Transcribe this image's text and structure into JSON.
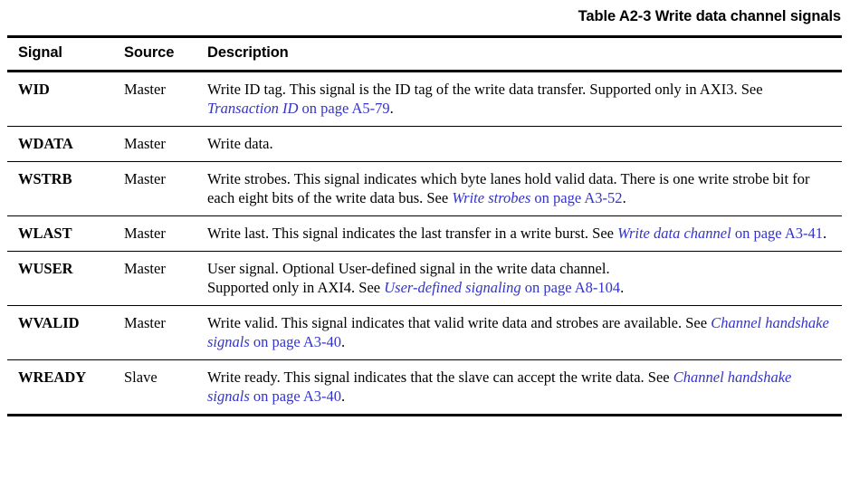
{
  "title": "Table A2-3 Write data channel signals",
  "colors": {
    "text": "#000000",
    "link": "#3333cc",
    "rule": "#000000",
    "background": "#ffffff"
  },
  "table": {
    "columns": [
      {
        "key": "signal",
        "label": "Signal"
      },
      {
        "key": "source",
        "label": "Source"
      },
      {
        "key": "description",
        "label": "Description"
      }
    ],
    "rows": [
      {
        "signal": "WID",
        "source": "Master",
        "description_lines": [
          {
            "text": "Write ID tag. This signal is the ID tag of the write data transfer. Supported only in AXI3. See ",
            "xref_title": "Transaction ID",
            "xref_page": " on page A5-79",
            "tail": "."
          }
        ]
      },
      {
        "signal": "WDATA",
        "source": "Master",
        "description_lines": [
          {
            "text": "Write data.",
            "xref_title": "",
            "xref_page": "",
            "tail": ""
          }
        ]
      },
      {
        "signal": "WSTRB",
        "source": "Master",
        "description_lines": [
          {
            "text": "Write strobes. This signal indicates which byte lanes hold valid data. There is one write strobe bit for each eight bits of the write data bus. See ",
            "xref_title": "Write strobes",
            "xref_page": " on page A3-52",
            "tail": "."
          }
        ]
      },
      {
        "signal": "WLAST",
        "source": "Master",
        "description_lines": [
          {
            "text": "Write last. This signal indicates the last transfer in a write burst. See ",
            "xref_title": "Write data channel",
            "xref_page": " on page A3-41",
            "tail": "."
          }
        ]
      },
      {
        "signal": "WUSER",
        "source": "Master",
        "description_lines": [
          {
            "text": "User signal. Optional User-defined signal in the write data channel.",
            "xref_title": "",
            "xref_page": "",
            "tail": ""
          },
          {
            "text": "Supported only in AXI4. See ",
            "xref_title": "User-defined signaling",
            "xref_page": " on page A8-104",
            "tail": "."
          }
        ]
      },
      {
        "signal": "WVALID",
        "source": "Master",
        "description_lines": [
          {
            "text": "Write valid. This signal indicates that valid write data and strobes are available. See ",
            "xref_title": "Channel handshake signals",
            "xref_page": " on page A3-40",
            "tail": "."
          }
        ]
      },
      {
        "signal": "WREADY",
        "source": "Slave",
        "description_lines": [
          {
            "text": "Write ready. This signal indicates that the slave can accept the write data. See ",
            "xref_title": "Channel handshake signals",
            "xref_page": " on page A3-40",
            "tail": "."
          }
        ]
      }
    ]
  }
}
